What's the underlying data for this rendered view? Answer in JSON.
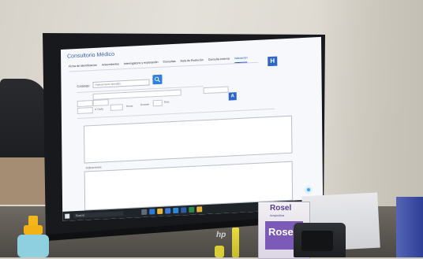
{
  "screen": {
    "app_title": "Consultorio Médico",
    "tabs": [
      "Ficha de Identificación",
      "Antecedentes",
      "Interrogatorio y exploración",
      "Consultas",
      "Nota de Evolución",
      "Consulta externa",
      "Valoración"
    ],
    "active_tab_index": 6,
    "header_button": "H",
    "catalog_label": "Catálogo",
    "catalog_placeholder": "Padecimiento atendido",
    "add_button": "A",
    "field_labels": {
      "cada": "c/ Cada",
      "horas": "Horas",
      "durante": "Durante",
      "dias": "Días"
    },
    "section_label": "Indicaciones",
    "taskbar": {
      "search_placeholder": "Buscar"
    }
  },
  "monitor": {
    "brand": "hp"
  },
  "products": {
    "box_brand": "Rosel",
    "box_sub": "Ampicilina"
  },
  "colors": {
    "accent": "#2f67c6",
    "taskbar": "#1f2428",
    "box_purple": "#7b5bb7"
  }
}
